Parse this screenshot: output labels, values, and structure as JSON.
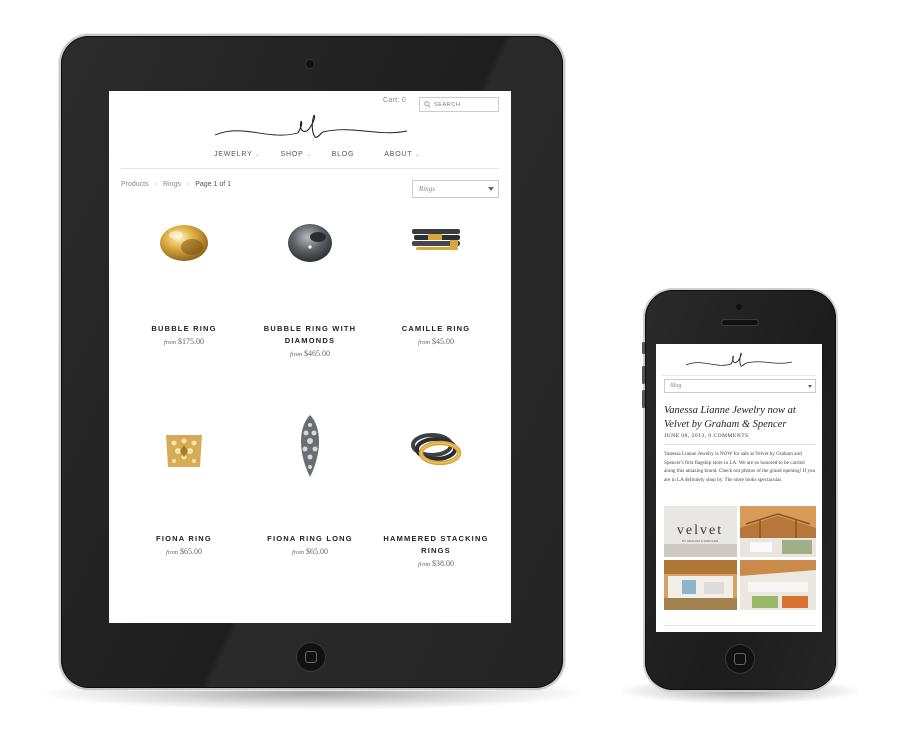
{
  "tablet": {
    "header": {
      "cart_label": "Cart: 0",
      "search_placeholder": "SEARCH"
    },
    "nav": [
      {
        "label": "JEWELRY",
        "has_dropdown": true
      },
      {
        "label": "SHOP",
        "has_dropdown": true
      },
      {
        "label": "BLOG",
        "has_dropdown": false
      },
      {
        "label": "ABOUT",
        "has_dropdown": true
      }
    ],
    "breadcrumb": {
      "products": "Products",
      "rings": "Rings",
      "page": "Page 1 of 1",
      "separator": "›"
    },
    "filter_select": {
      "value": "Rings"
    },
    "products": [
      {
        "name": "BUBBLE RING",
        "from": "from",
        "price": "$175.00",
        "icon": "gold-dome-ring"
      },
      {
        "name": "BUBBLE RING WITH DIAMONDS",
        "name_line1": "BUBBLE RING WITH",
        "name_line2": "DIAMONDS",
        "from": "from",
        "price": "$465.00",
        "icon": "oxidized-dome-ring"
      },
      {
        "name": "CAMILLE RING",
        "from": "from",
        "price": "$45.00",
        "icon": "stacked-band-rings"
      },
      {
        "name": "FIONA RING",
        "from": "from",
        "price": "$65.00",
        "icon": "gold-filigree-ring"
      },
      {
        "name": "FIONA RING LONG",
        "from": "from",
        "price": "$65.00",
        "icon": "silver-filigree-long-ring"
      },
      {
        "name": "HAMMERED STACKING RINGS",
        "name_line1": "HAMMERED STACKING",
        "name_line2": "RINGS",
        "from": "from",
        "price": "$38.00",
        "icon": "hammered-stacking-rings"
      }
    ]
  },
  "phone": {
    "filter_select": {
      "value": "Blog"
    },
    "post": {
      "title": "Vanessa Lianne Jewelry now at Velvet by Graham & Spencer",
      "meta": "JUNE 08, 2013, 0 COMMENTS",
      "body": "Vanessa Lianne Jewelry is NOW for sale at Velvet by Graham and Spencer's first flagship store in LA. We are so honored to be carried along this amazing brand. Check out photos of the grand opening! If you are in LA definitely shop by. The store looks spectacular.",
      "photo_sign": "velvet",
      "photo_sign_sub": "BY GRAHAM & SPENCER"
    }
  },
  "colors": {
    "device_body": "#222222",
    "gold": "#d4a63a",
    "oxidized": "#555a5f",
    "wood": "#c98a4a"
  }
}
